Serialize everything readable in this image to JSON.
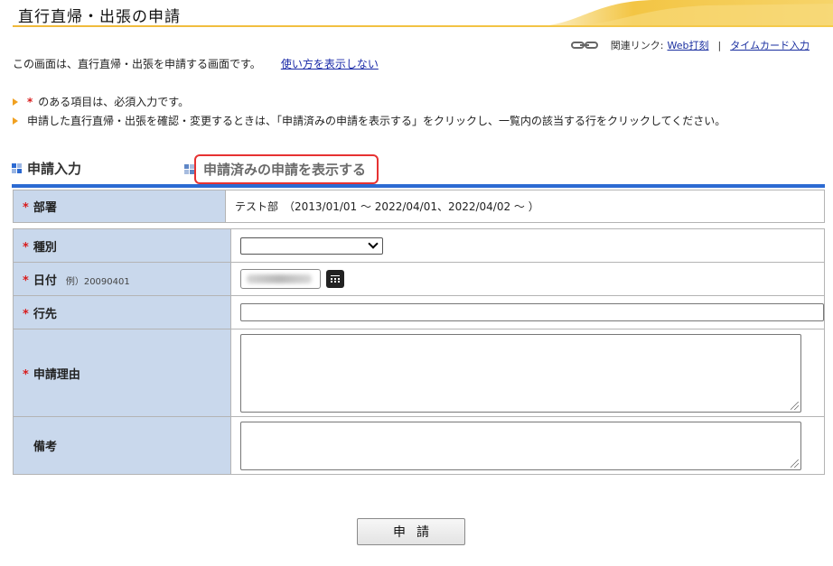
{
  "page": {
    "title": "直行直帰・出張の申請"
  },
  "related_links": {
    "label": "関連リンク:",
    "web_clock": "Web打刻",
    "separator": "|",
    "timecard": "タイムカード入力"
  },
  "intro": {
    "text": "この画面は、直行直帰・出張を申請する画面です。",
    "hide_help_link": "使い方を表示しない"
  },
  "notes": [
    {
      "required_mark": "*",
      "text": "のある項目は、必須入力です。"
    },
    {
      "text": "申請した直行直帰・出張を確認・変更するときは、「申請済みの申請を表示する」をクリックし、一覧内の該当する行をクリックしてください。"
    }
  ],
  "tabs": {
    "input": "申請入力",
    "submitted": "申請済みの申請を表示する"
  },
  "form": {
    "department": {
      "label": "部署",
      "required": "*",
      "value": "テスト部　（2013/01/01 ～ 2022/04/01、2022/04/02 ～ ）"
    },
    "type": {
      "label": "種別",
      "required": "*",
      "value": ""
    },
    "date": {
      "label": "日付",
      "required": "*",
      "example": "例）20090401"
    },
    "destination": {
      "label": "行先",
      "required": "*",
      "value": ""
    },
    "reason": {
      "label": "申請理由",
      "required": "*",
      "value": ""
    },
    "remarks": {
      "label": "備考",
      "value": ""
    }
  },
  "submit_label": "申請",
  "colors": {
    "accent_blue": "#2c6ad2",
    "label_bg": "#c9d8ec",
    "required_red": "#d81c1c",
    "highlight_red": "#e63232",
    "header_gold": "#f0b93a"
  },
  "icons": [
    "chain-link-icon",
    "bullet-triangle-icon",
    "tab-grid-icon",
    "calendar-icon",
    "chevron-down-icon",
    "resize-grip-icon"
  ]
}
